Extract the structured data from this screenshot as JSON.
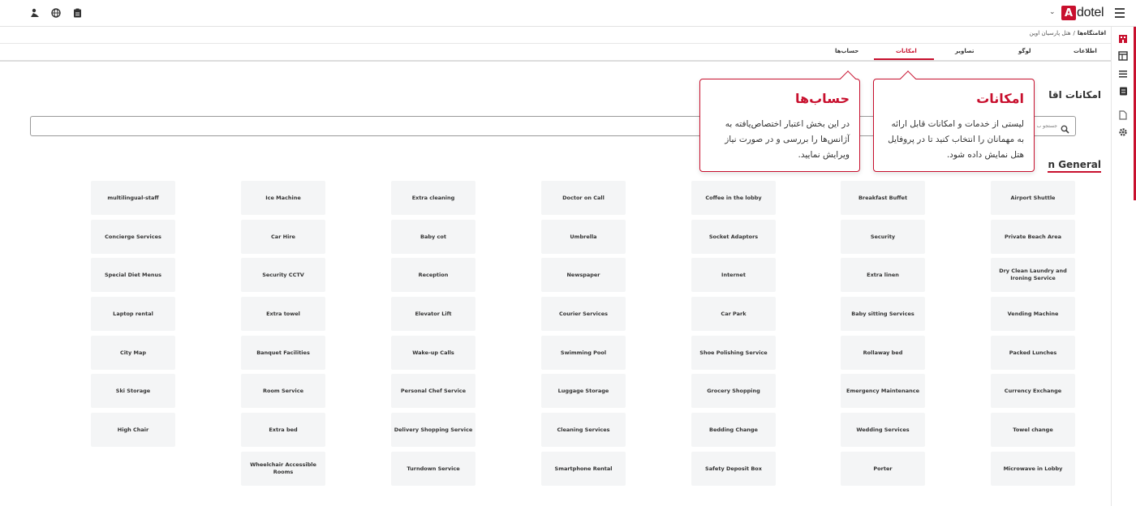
{
  "app": {
    "brand_letter": "A",
    "brand_rest": "dotel",
    "accent": "#c8102e"
  },
  "breadcrumb": {
    "root": "اقامتگاه‌ها",
    "separator": "/",
    "current": "هتل پارسیان اوین"
  },
  "tabs": [
    "اطلاعات",
    "لوگو",
    "تصاویر",
    "امکانات",
    "حساب‌ها"
  ],
  "active_tab": "امکانات",
  "section_title": "امکانات اقا",
  "search": {
    "placeholder": "جستجو ب"
  },
  "group_title": "n General",
  "amenities": [
    "Airport Shuttle",
    "Breakfast Buffet",
    "Coffee in the lobby",
    "Doctor on Call",
    "Extra cleaning",
    "Ice Machine",
    "multilingual-staff",
    "Private Beach Area",
    "Security",
    "Socket Adaptors",
    "Umbrella",
    "Baby cot",
    "Car Hire",
    "Concierge Services",
    "Dry Clean Laundry and Ironing Service",
    "Extra linen",
    "Internet",
    "Newspaper",
    "Reception",
    "Security CCTV",
    "Special Diet Menus",
    "Vending Machine",
    "Baby sitting Services",
    "Car Park",
    "Courier Services",
    "Elevator Lift",
    "Extra towel",
    "Laptop rental",
    "Packed Lunches",
    "Rollaway bed",
    "Shoe Polishing Service",
    "Swimming Pool",
    "Wake-up Calls",
    "Banquet Facilities",
    "City Map",
    "Currency Exchange",
    "Emergency Maintenance",
    "Grocery Shopping",
    "Luggage Storage",
    "Personal Chef Service",
    "Room Service",
    "Ski Storage",
    "Towel change",
    "Wedding Services",
    "Bedding Change",
    "Cleaning Services",
    "Delivery Shopping Service",
    "Extra bed",
    "High Chair",
    "Microwave in Lobby",
    "Porter",
    "Safety Deposit Box",
    "Smartphone Rental",
    "Turndown Service",
    "Wheelchair Accessible Rooms"
  ],
  "callouts": [
    {
      "title": "امکانات",
      "body": "لیستی از خدمات و امکانات قابل ارائه به مهمانان را انتخاب کنید تا در پروفایل هتل نمایش داده شود."
    },
    {
      "title": "حساب‌ها",
      "body": "در این بخش اعتبار اختصاص‌یافته به آژانس‌ها را بررسی و در صورت نیاز ویرایش نمایید."
    }
  ]
}
